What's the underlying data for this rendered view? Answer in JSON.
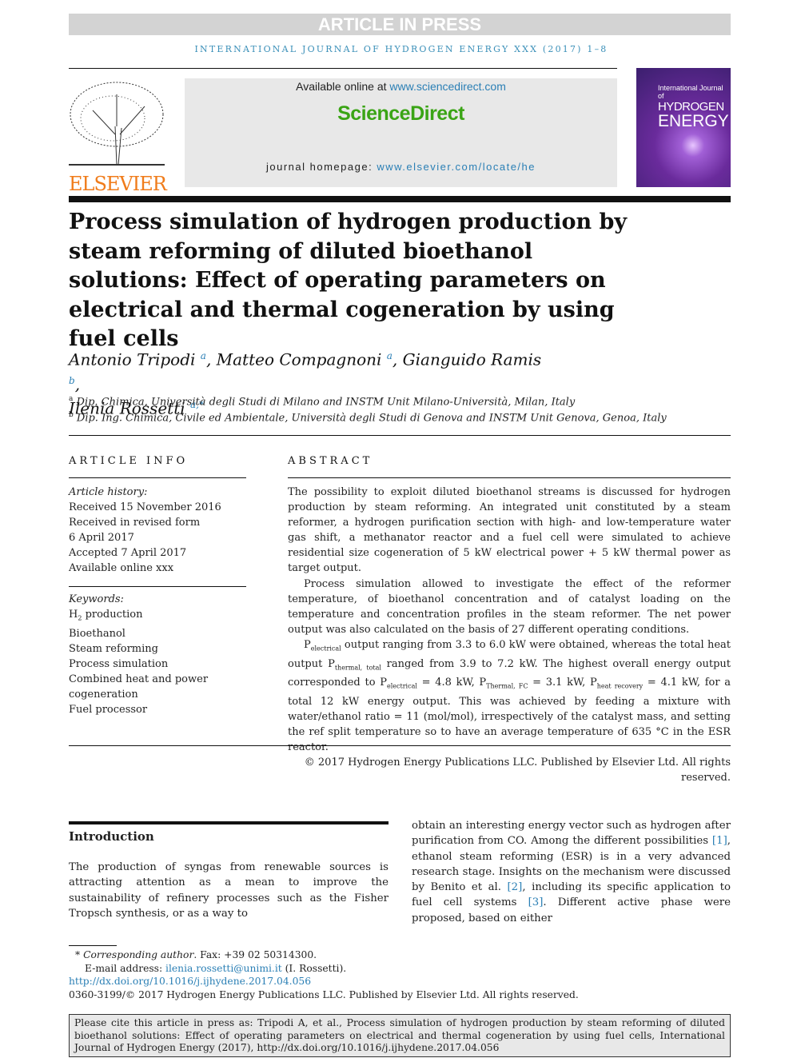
{
  "header": {
    "banner": "ARTICLE IN PRESS",
    "journal_line": "INTERNATIONAL JOURNAL OF HYDROGEN ENERGY XXX (2017) 1–8"
  },
  "masthead": {
    "publisher_logo": "ELSEVIER",
    "available_prefix": "Available online at ",
    "available_link": "www.sciencedirect.com",
    "platform": "ScienceDirect",
    "homepage_prefix": "journal homepage: ",
    "homepage_link": "www.elsevier.com/locate/he",
    "cover": {
      "line1": "International Journal of",
      "line2": "HYDROGEN",
      "line3": "ENERGY"
    }
  },
  "article": {
    "title": "Process simulation of hydrogen production by steam reforming of diluted bioethanol solutions: Effect of operating parameters on electrical and thermal cogeneration by using fuel cells",
    "authors": [
      {
        "name": "Antonio Tripodi",
        "sup": "a"
      },
      {
        "name": "Matteo Compagnoni",
        "sup": "a"
      },
      {
        "name": "Gianguido Ramis",
        "sup": "b"
      },
      {
        "name": "Ilenia Rossetti",
        "sup": "a,*"
      }
    ],
    "affiliations": [
      {
        "sup": "a",
        "text": "Dip. Chimica, Università degli Studi di Milano and INSTM Unit Milano-Università, Milan, Italy"
      },
      {
        "sup": "b",
        "text": "Dip. Ing. Chimica, Civile ed Ambientale, Università degli Studi di Genova and INSTM Unit Genova, Genoa, Italy"
      }
    ]
  },
  "info": {
    "heading": "ARTICLE INFO",
    "history_label": "Article history:",
    "history": [
      "Received 15 November 2016",
      "Received in revised form",
      "6 April 2017",
      "Accepted 7 April 2017",
      "Available online xxx"
    ],
    "keywords_label": "Keywords:",
    "kw_h2": "H",
    "kw_h2_sub": "2",
    "kw_h2_rest": " production",
    "keywords": [
      "Bioethanol",
      "Steam reforming",
      "Process simulation",
      "Combined heat and power",
      "cogeneration",
      "Fuel processor"
    ]
  },
  "abstract": {
    "heading": "ABSTRACT",
    "p1": "The possibility to exploit diluted bioethanol streams is discussed for hydrogen production by steam reforming. An integrated unit constituted by a steam reformer, a hydrogen purification section with high- and low-temperature water gas shift, a methanator reactor and a fuel cell were simulated to achieve residential size cogeneration of 5 kW electrical power + 5 kW thermal power as target output.",
    "p2": "Process simulation allowed to investigate the effect of the reformer temperature, of bioethanol concentration and of catalyst loading on the temperature and concentration profiles in the steam reformer. The net power output was also calculated on the basis of 27 different operating conditions.",
    "p3": {
      "s1": "P",
      "sub1": "electrical",
      "t1": " output ranging from 3.3 to 6.0 kW were obtained, whereas the total heat output P",
      "sub2": "thermal, total",
      "t2": " ranged from 3.9 to 7.2 kW. The highest overall energy output corresponded to P",
      "sub3": "electrical",
      "t3": " = 4.8 kW, P",
      "sub4": "Thermal, FC",
      "t4": " = 3.1 kW, P",
      "sub5": "heat recovery",
      "t5": " = 4.1 kW, for a total 12 kW energy output. This was achieved by feeding a mixture with water/ethanol ratio = 11 (mol/mol), irrespectively of the catalyst mass, and setting the ref split temperature so to have an average temperature of 635 °C in the ESR reactor."
    },
    "copyright": "© 2017 Hydrogen Energy Publications LLC. Published by Elsevier Ltd. All rights reserved."
  },
  "intro": {
    "heading": "Introduction",
    "left": "The production of syngas from renewable sources is attracting attention as a mean to improve the sustainability of refinery processes such as the Fisher Tropsch synthesis, or as a way to",
    "r1": "obtain an interesting energy vector such as hydrogen after purification from CO. Among the different possibilities ",
    "ref1": "[1]",
    "r2": ", ethanol steam reforming (ESR) is in a very advanced research stage. Insights on the mechanism were discussed by Benito et al. ",
    "ref2": "[2]",
    "r3": ", including its specific application to fuel cell systems ",
    "ref3": "[3]",
    "r4": ". Different active phase were proposed, based on either"
  },
  "footnote": {
    "star": "*",
    "corr_label": "Corresponding author",
    "corr_rest": ". Fax: +39 02 50314300.",
    "email_label": "E-mail address: ",
    "email": "ilenia.rossetti@unimi.it",
    "email_rest": " (I. Rossetti).",
    "doi": "http://dx.doi.org/10.1016/j.ijhydene.2017.04.056",
    "issn": "0360-3199/© 2017 Hydrogen Energy Publications LLC. Published by Elsevier Ltd. All rights reserved."
  },
  "citation": "Please cite this article in press as: Tripodi A, et al., Process simulation of hydrogen production by steam reforming of diluted bioethanol solutions: Effect of operating parameters on electrical and thermal cogeneration by using fuel cells, International Journal of Hydrogen Energy (2017), http://dx.doi.org/10.1016/j.ijhydene.2017.04.056",
  "colors": {
    "link": "#2a7fb5",
    "sciencedirect": "#3aa415",
    "elsevier": "#f07c1b",
    "banner": "#d3d3d3"
  }
}
